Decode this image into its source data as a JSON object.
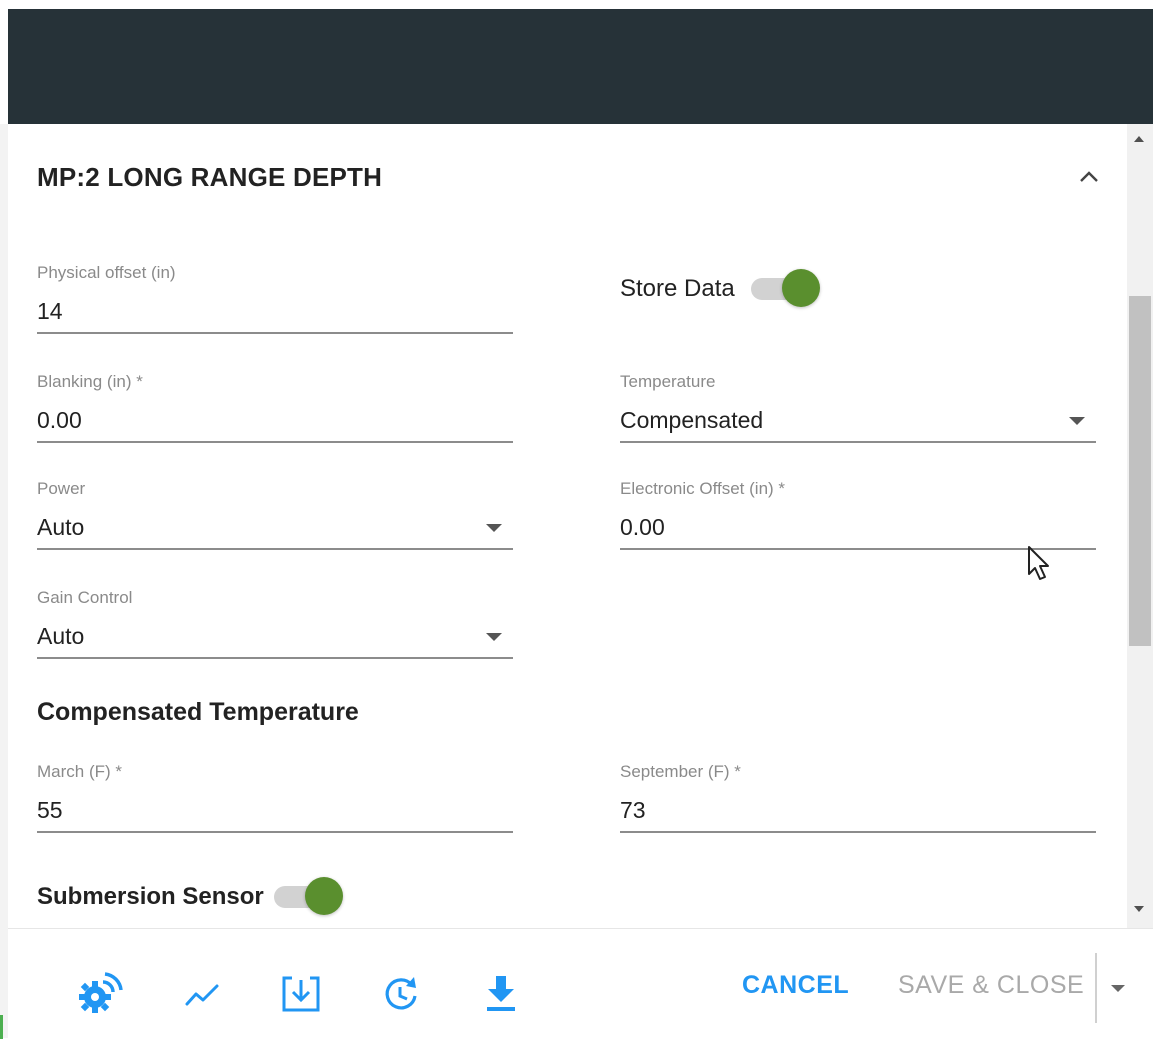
{
  "section": {
    "title": "MP:2 LONG RANGE DEPTH"
  },
  "fields": {
    "physical_offset": {
      "label": "Physical offset (in)",
      "value": "14"
    },
    "blanking": {
      "label": "Blanking (in) *",
      "value": "0.00"
    },
    "temperature": {
      "label": "Temperature",
      "value": "Compensated"
    },
    "power": {
      "label": "Power",
      "value": "Auto"
    },
    "electronic_offset": {
      "label": "Electronic Offset (in) *",
      "value": "0.00"
    },
    "gain_control": {
      "label": "Gain Control",
      "value": "Auto"
    },
    "march": {
      "label": "March (F) *",
      "value": "55"
    },
    "september": {
      "label": "September (F) *",
      "value": "73"
    }
  },
  "toggles": {
    "store_data": {
      "label": "Store Data",
      "on": true
    },
    "submersion_sensor": {
      "label": "Submersion Sensor",
      "on": true
    }
  },
  "compensated_heading": "Compensated Temperature",
  "footer": {
    "icons": [
      "settings-signal-icon",
      "trend-chart-icon",
      "download-box-icon",
      "history-icon",
      "download-icon"
    ],
    "cancel_label": "CANCEL",
    "save_label": "SAVE & CLOSE"
  },
  "colors": {
    "accent": "#2196f3",
    "toggle_on": "#5a8f2e",
    "topbar": "#263238"
  }
}
